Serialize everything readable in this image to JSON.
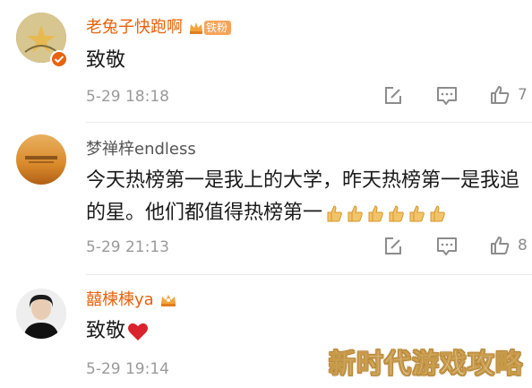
{
  "comments": [
    {
      "username": "老兔子快跑啊",
      "badge_label": "铁粉",
      "text": "致敬",
      "date": "5-29 18:18",
      "likes": "7"
    },
    {
      "username": "梦禅梓endless",
      "text": "今天热榜第一是我上的大学，昨天热榜第一是我追的星。他们都值得热榜第一",
      "date": "5-29 21:13",
      "likes": "8"
    },
    {
      "username": "囍楝楝ya",
      "text": "致敬",
      "date": "5-29 19:14"
    }
  ],
  "watermark": "新时代游戏攻略",
  "colors": {
    "username_orange": "#e8620c",
    "username_gray": "#555555",
    "meta_gray": "#9a9a9a",
    "heart_red": "#d9232d"
  },
  "icons": [
    "edit-icon",
    "comment-icon",
    "thumbs-up-icon",
    "heart-icon",
    "crown-badge-icon",
    "verified-badge-icon"
  ]
}
